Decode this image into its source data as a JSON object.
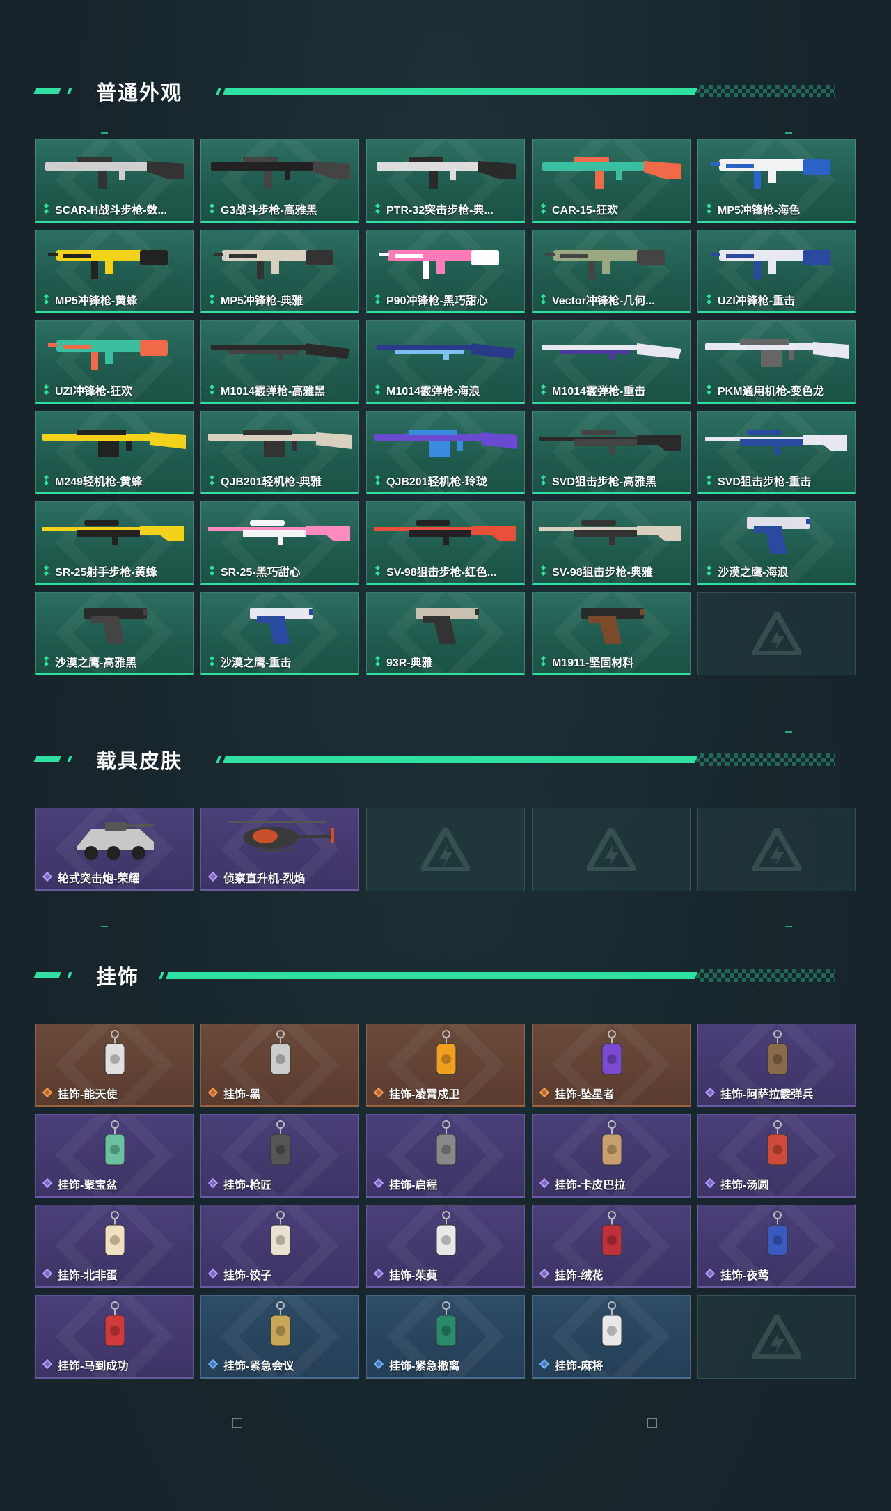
{
  "sections": {
    "skins": {
      "title": "普通外观"
    },
    "vehicles": {
      "title": "载具皮肤"
    },
    "charms": {
      "title": "挂饰"
    }
  },
  "weapon_skins": [
    {
      "label": "SCAR-H战斗步枪-数...",
      "rarity": "green",
      "icon": "rifle-icon"
    },
    {
      "label": "G3战斗步枪-高雅黑",
      "rarity": "green",
      "icon": "rifle-icon"
    },
    {
      "label": "PTR-32突击步枪-典...",
      "rarity": "green",
      "icon": "rifle-icon"
    },
    {
      "label": "CAR-15-狂欢",
      "rarity": "green",
      "icon": "rifle-icon"
    },
    {
      "label": "MP5冲锋枪-海色",
      "rarity": "green",
      "icon": "smg-icon"
    },
    {
      "label": "MP5冲锋枪-黄蜂",
      "rarity": "green",
      "icon": "smg-icon"
    },
    {
      "label": "MP5冲锋枪-典雅",
      "rarity": "green",
      "icon": "smg-icon"
    },
    {
      "label": "P90冲锋枪-黑巧甜心",
      "rarity": "green",
      "icon": "smg-icon"
    },
    {
      "label": "Vector冲锋枪-几何...",
      "rarity": "green",
      "icon": "smg-icon"
    },
    {
      "label": "UZI冲锋枪-重击",
      "rarity": "green",
      "icon": "smg-icon"
    },
    {
      "label": "UZI冲锋枪-狂欢",
      "rarity": "green",
      "icon": "smg-icon"
    },
    {
      "label": "M1014霰弹枪-高雅黑",
      "rarity": "green",
      "icon": "shotgun-icon"
    },
    {
      "label": "M1014霰弹枪-海浪",
      "rarity": "green",
      "icon": "shotgun-icon"
    },
    {
      "label": "M1014霰弹枪-重击",
      "rarity": "green",
      "icon": "shotgun-icon"
    },
    {
      "label": "PKM通用机枪-变色龙",
      "rarity": "green",
      "icon": "machine-gun-icon"
    },
    {
      "label": "M249轻机枪-黄蜂",
      "rarity": "green",
      "icon": "machine-gun-icon"
    },
    {
      "label": "QJB201轻机枪-典雅",
      "rarity": "green",
      "icon": "machine-gun-icon"
    },
    {
      "label": "QJB201轻机枪-玲珑",
      "rarity": "green",
      "icon": "machine-gun-icon"
    },
    {
      "label": "SVD狙击步枪-高雅黑",
      "rarity": "green",
      "icon": "sniper-icon"
    },
    {
      "label": "SVD狙击步枪-重击",
      "rarity": "green",
      "icon": "sniper-icon"
    },
    {
      "label": "SR-25射手步枪-黄蜂",
      "rarity": "green",
      "icon": "sniper-icon"
    },
    {
      "label": "SR-25-黑巧甜心",
      "rarity": "green",
      "icon": "sniper-icon"
    },
    {
      "label": "SV-98狙击步枪-红色...",
      "rarity": "green",
      "icon": "sniper-icon"
    },
    {
      "label": "SV-98狙击步枪-典雅",
      "rarity": "green",
      "icon": "sniper-icon"
    },
    {
      "label": "沙漠之鹰-海浪",
      "rarity": "green",
      "icon": "pistol-icon"
    },
    {
      "label": "沙漠之鹰-高雅黑",
      "rarity": "green",
      "icon": "pistol-icon"
    },
    {
      "label": "沙漠之鹰-重击",
      "rarity": "green",
      "icon": "pistol-icon"
    },
    {
      "label": "93R-典雅",
      "rarity": "green",
      "icon": "pistol-icon"
    },
    {
      "label": "M1911-坚固材料",
      "rarity": "green",
      "icon": "pistol-icon"
    }
  ],
  "vehicle_skins": [
    {
      "label": "轮式突击炮-荣耀",
      "rarity": "purple",
      "icon": "vehicle-icon"
    },
    {
      "label": "侦察直升机-烈焰",
      "rarity": "purple",
      "icon": "helicopter-icon"
    }
  ],
  "charms": [
    {
      "label": "挂饰-能天使",
      "rarity": "orange",
      "icon": "charm-icon"
    },
    {
      "label": "挂饰-黑",
      "rarity": "orange",
      "icon": "charm-icon"
    },
    {
      "label": "挂饰-凌霄戍卫",
      "rarity": "orange",
      "icon": "charm-icon"
    },
    {
      "label": "挂饰-坠星者",
      "rarity": "orange",
      "icon": "charm-icon"
    },
    {
      "label": "挂饰-阿萨拉霰弹兵",
      "rarity": "purple",
      "icon": "charm-icon"
    },
    {
      "label": "挂饰-聚宝盆",
      "rarity": "purple",
      "icon": "charm-icon"
    },
    {
      "label": "挂饰-枪匠",
      "rarity": "purple",
      "icon": "charm-icon"
    },
    {
      "label": "挂饰-启程",
      "rarity": "purple",
      "icon": "charm-icon"
    },
    {
      "label": "挂饰-卡皮巴拉",
      "rarity": "purple",
      "icon": "charm-icon"
    },
    {
      "label": "挂饰-汤圆",
      "rarity": "purple",
      "icon": "charm-icon"
    },
    {
      "label": "挂饰-北非蛋",
      "rarity": "purple",
      "icon": "charm-icon"
    },
    {
      "label": "挂饰-饺子",
      "rarity": "purple",
      "icon": "charm-icon"
    },
    {
      "label": "挂饰-茱萸",
      "rarity": "purple",
      "icon": "charm-icon"
    },
    {
      "label": "挂饰-绒花",
      "rarity": "purple",
      "icon": "charm-icon"
    },
    {
      "label": "挂饰-夜莺",
      "rarity": "purple",
      "icon": "charm-icon"
    },
    {
      "label": "挂饰-马到成功",
      "rarity": "purple",
      "icon": "charm-icon"
    },
    {
      "label": "挂饰-紧急会议",
      "rarity": "blue",
      "icon": "charm-icon"
    },
    {
      "label": "挂饰-紧急撤离",
      "rarity": "blue",
      "icon": "charm-icon"
    },
    {
      "label": "挂饰-麻将",
      "rarity": "blue",
      "icon": "charm-icon"
    }
  ],
  "colors": {
    "accent": "#2fe0a0",
    "green_card": "#1f5a4d",
    "purple_card": "#3d3466",
    "orange_card": "#5a3c2f",
    "blue_card": "#253f57",
    "background": "#17242b"
  }
}
